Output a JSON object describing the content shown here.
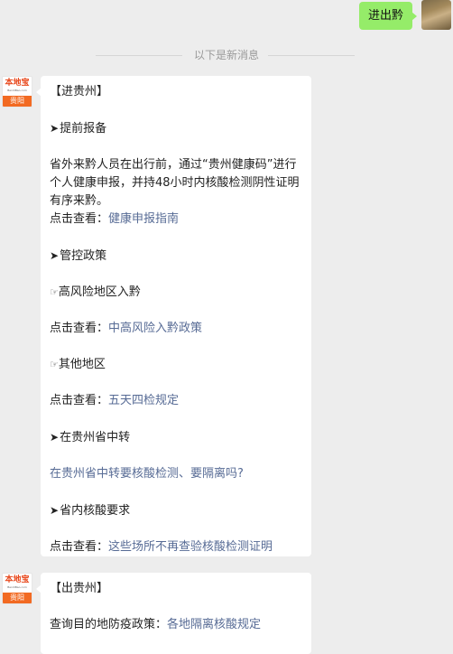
{
  "outgoing": {
    "text": "进出黔"
  },
  "divider": {
    "text": "以下是新消息"
  },
  "bot_avatar": {
    "brand": "本地宝",
    "brand_sub": "BendiBao.com",
    "city": "贵阳"
  },
  "msg1": {
    "heading": "【进贵州】",
    "s1_title": "提前报备",
    "s1_body": "省外来黔人员在出行前，通过“贵州健康码”进行个人健康申报，并持48小时内核酸检测阴性证明有序来黔。",
    "s1_prefix": "点击查看：",
    "s1_link": "健康申报指南",
    "s2_title": "管控政策",
    "s2_sub1": "高风险地区入黔",
    "s2_prefix1": "点击查看：",
    "s2_link1": "中高风险入黔政策",
    "s2_sub2": "其他地区",
    "s2_prefix2": "点击查看：",
    "s2_link2": "五天四检规定",
    "s3_title": "在贵州省中转",
    "s3_link": "在贵州省中转要核酸检测、要隔离吗?",
    "s4_title": "省内核酸要求",
    "s4_prefix": "点击查看：",
    "s4_link": "这些场所不再查验核酸检测证明"
  },
  "msg2": {
    "heading": "【出贵州】",
    "prefix": "查询目的地防疫政策：",
    "link": "各地隔离核酸规定"
  },
  "icons": {
    "arrow": "➤",
    "hand": "☞"
  },
  "colors": {
    "bubble_out": "#95ec69",
    "link": "#576b95",
    "background": "#ededed"
  }
}
